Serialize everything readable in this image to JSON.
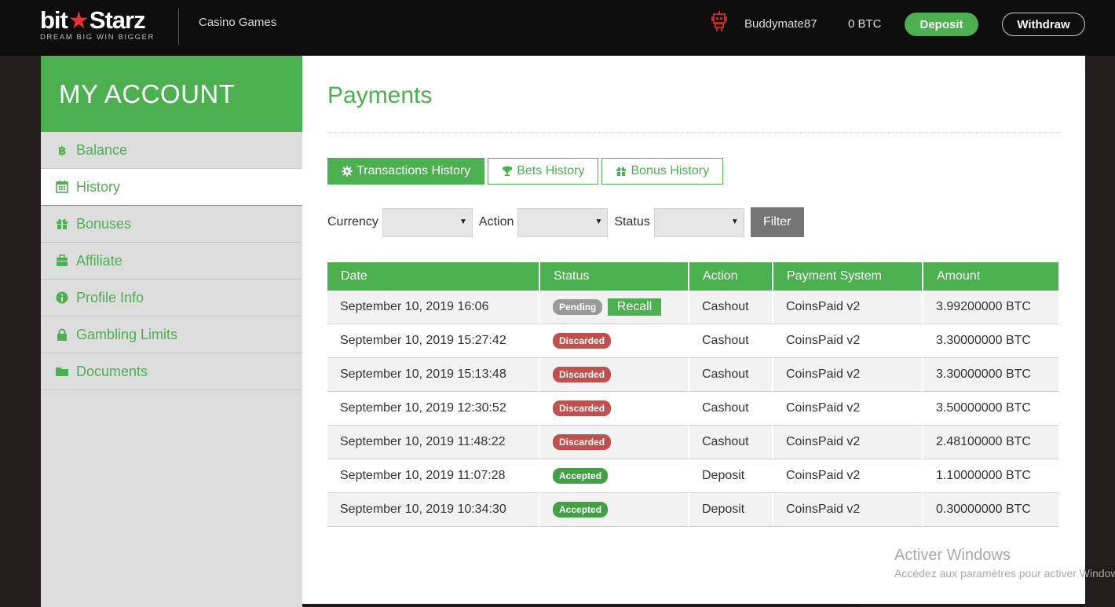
{
  "header": {
    "logo_main_left": "bit",
    "logo_main_right": "Starz",
    "logo_tagline": "DREAM BIG  WIN BIGGER",
    "nav_games": "Casino Games",
    "username": "Buddymate87",
    "balance": "0 BTC",
    "deposit_label": "Deposit",
    "withdraw_label": "Withdraw",
    "robot_icon": "robot-icon"
  },
  "colors": {
    "accent": "#4caf50",
    "pending": "#999999",
    "discarded": "#c0504d",
    "accepted": "#43a047",
    "header_bg": "#0e0e0e",
    "sidebar_bg": "#dddddd",
    "filter_button": "#757575"
  },
  "sidebar": {
    "title": "MY ACCOUNT",
    "items": [
      {
        "label": "Balance",
        "icon": "bitcoin-icon"
      },
      {
        "label": "History",
        "icon": "calendar-icon"
      },
      {
        "label": "Bonuses",
        "icon": "gift-icon"
      },
      {
        "label": "Affiliate",
        "icon": "briefcase-icon"
      },
      {
        "label": "Profile Info",
        "icon": "info-icon"
      },
      {
        "label": "Gambling Limits",
        "icon": "lock-icon"
      },
      {
        "label": "Documents",
        "icon": "folder-icon"
      }
    ],
    "active_item": "History"
  },
  "main": {
    "title": "Payments",
    "tabs": [
      {
        "label": "Transactions History",
        "icon": "gear-icon"
      },
      {
        "label": "Bets History",
        "icon": "trophy-icon"
      },
      {
        "label": "Bonus History",
        "icon": "gift-icon"
      }
    ],
    "active_tab": "Transactions History",
    "filters": {
      "currency_label": "Currency",
      "action_label": "Action",
      "status_label": "Status",
      "currency_value": "",
      "action_value": "",
      "status_value": "",
      "filter_button": "Filter"
    },
    "table": {
      "columns": [
        "Date",
        "Status",
        "Action",
        "Payment System",
        "Amount"
      ],
      "rows": [
        {
          "date": "September 10, 2019 16:06",
          "status": "Pending",
          "recall": "Recall",
          "action": "Cashout",
          "system": "CoinsPaid v2",
          "amount": "3.99200000 BTC"
        },
        {
          "date": "September 10, 2019 15:27:42",
          "status": "Discarded",
          "action": "Cashout",
          "system": "CoinsPaid v2",
          "amount": "3.30000000 BTC"
        },
        {
          "date": "September 10, 2019 15:13:48",
          "status": "Discarded",
          "action": "Cashout",
          "system": "CoinsPaid v2",
          "amount": "3.30000000 BTC"
        },
        {
          "date": "September 10, 2019 12:30:52",
          "status": "Discarded",
          "action": "Cashout",
          "system": "CoinsPaid v2",
          "amount": "3.50000000 BTC"
        },
        {
          "date": "September 10, 2019 11:48:22",
          "status": "Discarded",
          "action": "Cashout",
          "system": "CoinsPaid v2",
          "amount": "2.48100000 BTC"
        },
        {
          "date": "September 10, 2019 11:07:28",
          "status": "Accepted",
          "action": "Deposit",
          "system": "CoinsPaid v2",
          "amount": "1.10000000 BTC"
        },
        {
          "date": "September 10, 2019 10:34:30",
          "status": "Accepted",
          "action": "Deposit",
          "system": "CoinsPaid v2",
          "amount": "0.30000000 BTC"
        }
      ]
    }
  },
  "watermark": {
    "title": "Activer Windows",
    "subtitle": "Accédez aux paramètres pour activer Windows."
  }
}
